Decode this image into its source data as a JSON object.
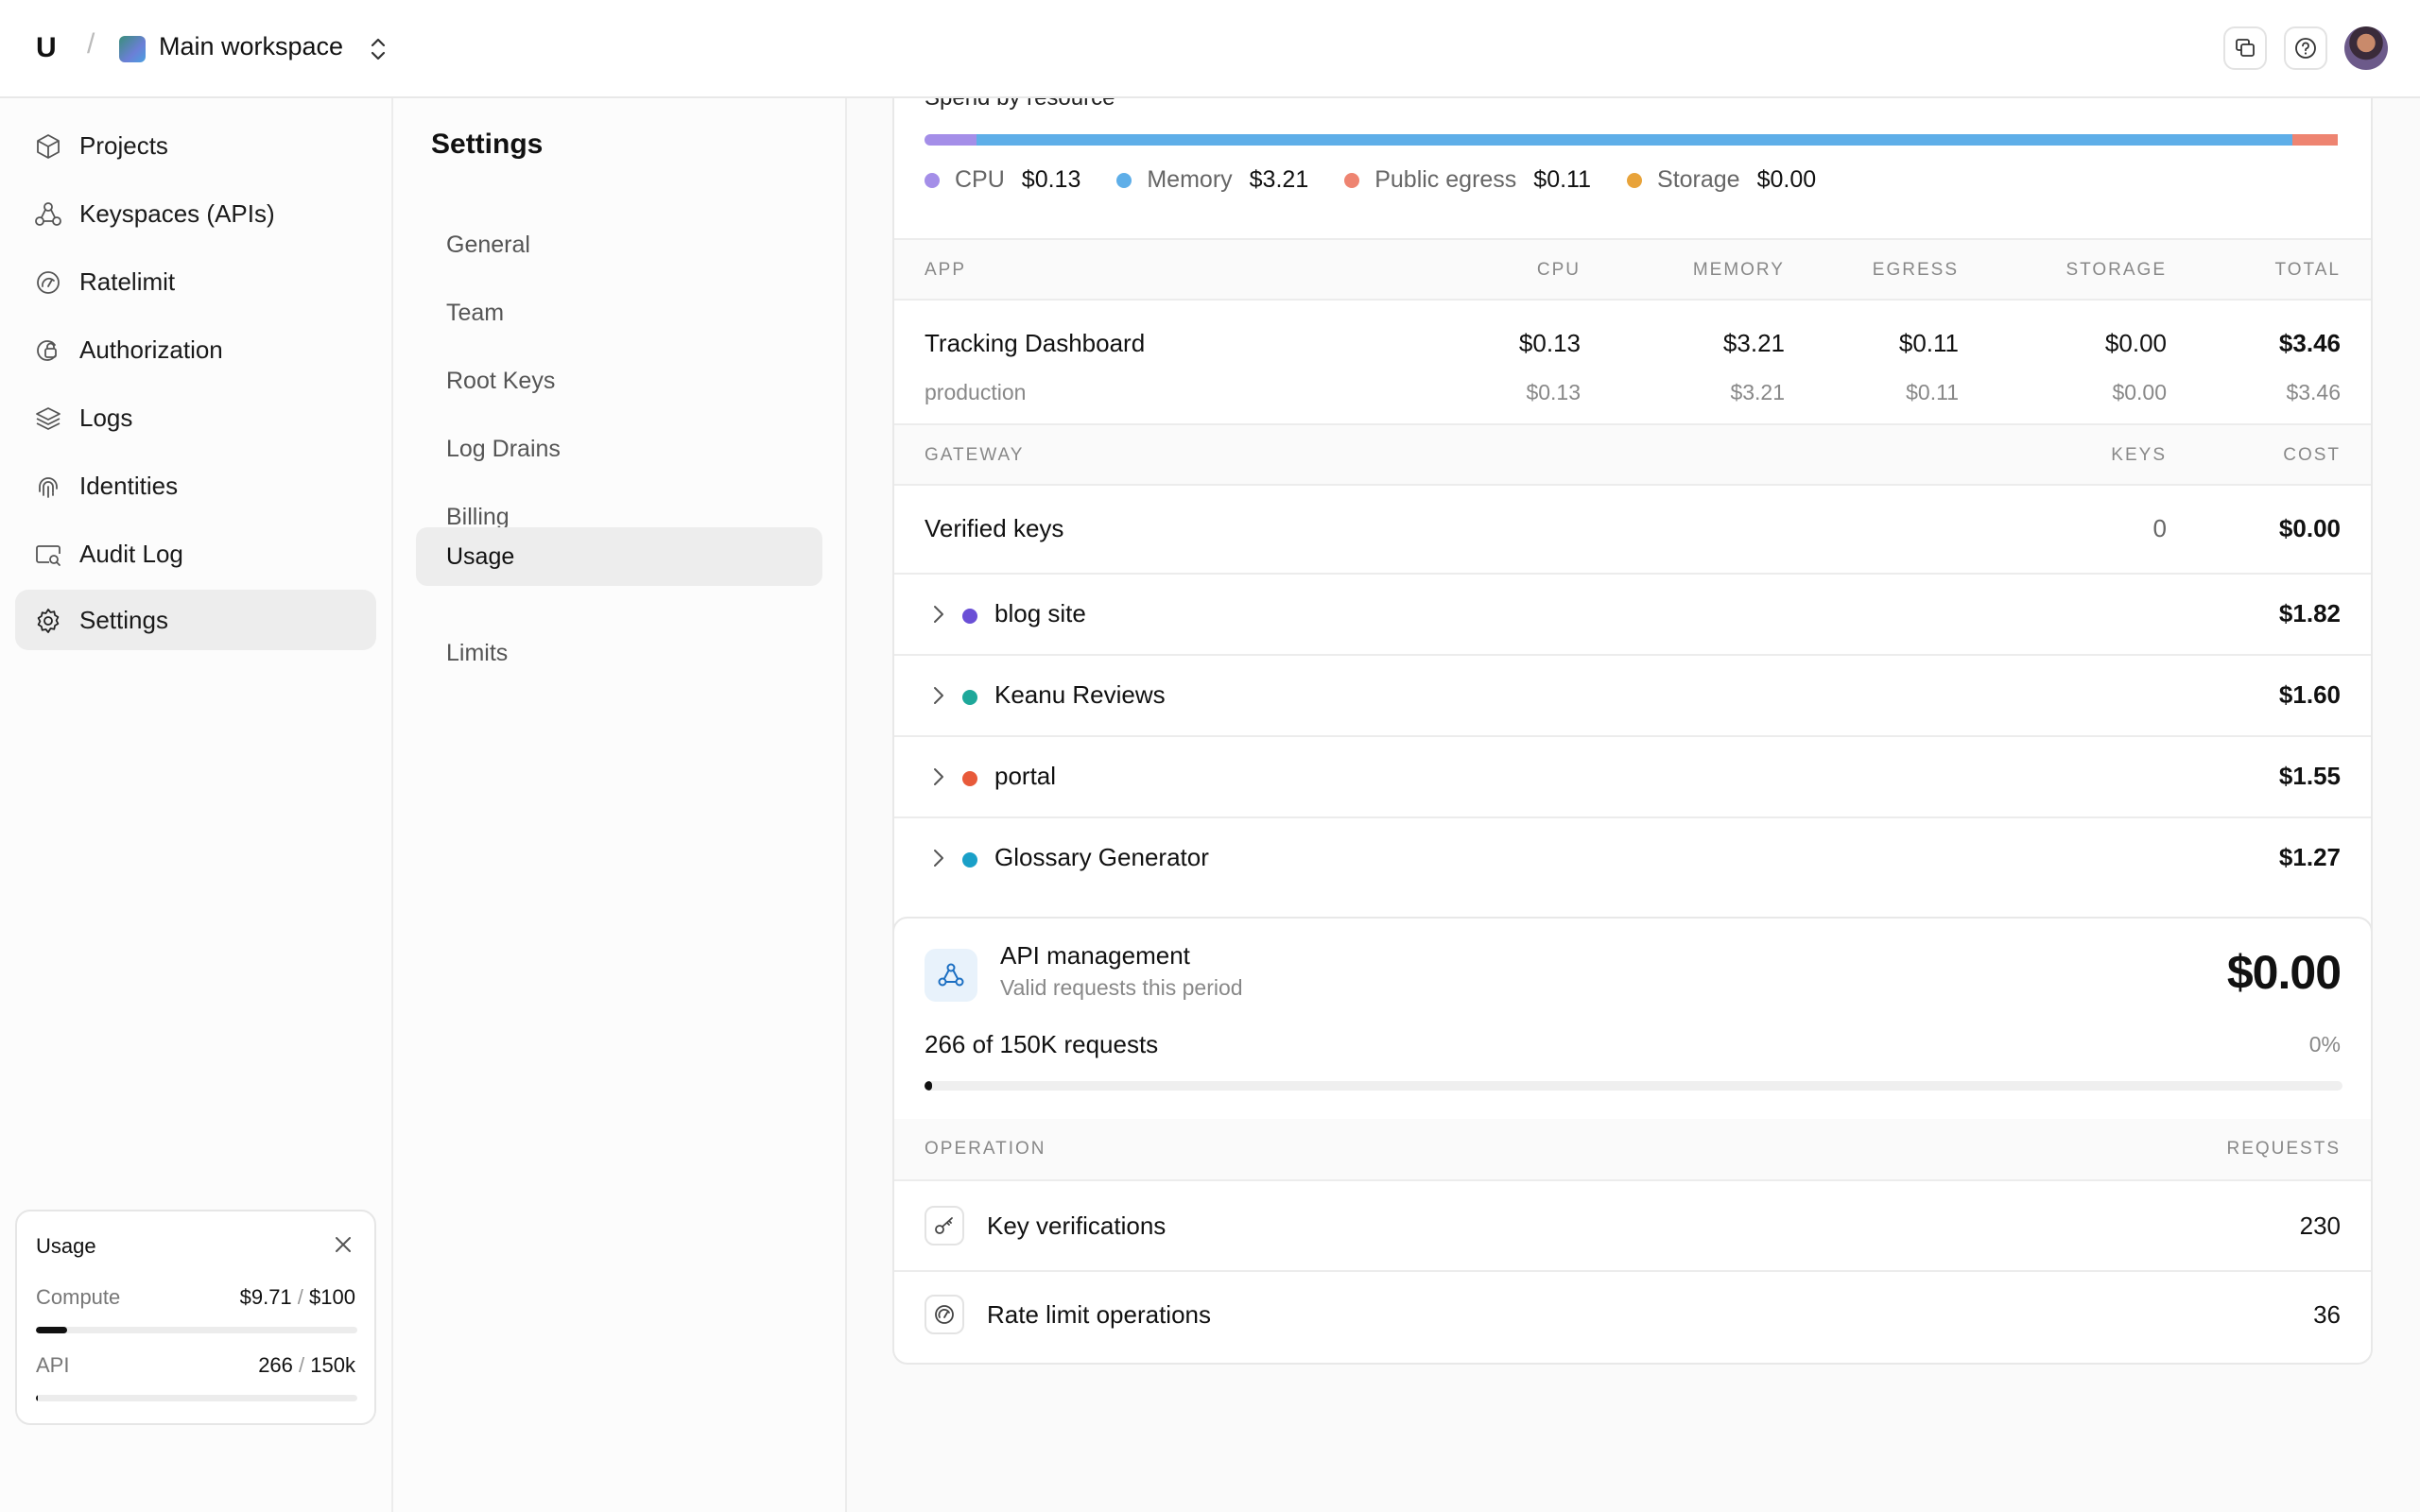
{
  "topbar": {
    "logo": "U",
    "separator": "/",
    "workspace_name": "Main workspace"
  },
  "sidebar": {
    "items": [
      {
        "label": "Projects",
        "icon": "cube-icon"
      },
      {
        "label": "Keyspaces (APIs)",
        "icon": "nodes-icon"
      },
      {
        "label": "Ratelimit",
        "icon": "gauge-icon"
      },
      {
        "label": "Authorization",
        "icon": "shield-lock-icon"
      },
      {
        "label": "Logs",
        "icon": "layers-icon"
      },
      {
        "label": "Identities",
        "icon": "fingerprint-icon"
      },
      {
        "label": "Audit Log",
        "icon": "search-window-icon"
      },
      {
        "label": "Settings",
        "icon": "gear-icon"
      }
    ],
    "active": "Settings",
    "usage_card": {
      "title": "Usage",
      "compute_label": "Compute",
      "compute_used": "$9.71",
      "compute_sep": "/",
      "compute_limit": "$100",
      "compute_fraction": 0.0971,
      "api_label": "API",
      "api_used": "266",
      "api_sep": "/",
      "api_limit": "150k",
      "api_fraction": 0.0018
    }
  },
  "settings": {
    "title": "Settings",
    "items": [
      "General",
      "Team",
      "Root Keys",
      "Log Drains",
      "Billing",
      "Usage",
      "Limits"
    ],
    "active": "Usage"
  },
  "spend": {
    "title": "Spend by resource",
    "colors": {
      "cpu": "#a48ee8",
      "memory": "#5eaee8",
      "egress": "#ee8471",
      "storage": "#e8a33a"
    },
    "fractions": {
      "cpu": 0.037,
      "memory": 0.928,
      "egress": 0.032,
      "storage": 0.0
    },
    "legend": [
      {
        "name": "CPU",
        "value": "$0.13"
      },
      {
        "name": "Memory",
        "value": "$3.21"
      },
      {
        "name": "Public egress",
        "value": "$0.11"
      },
      {
        "name": "Storage",
        "value": "$0.00"
      }
    ]
  },
  "app_table": {
    "headers": [
      "APP",
      "CPU",
      "MEMORY",
      "EGRESS",
      "STORAGE",
      "TOTAL"
    ],
    "row": {
      "name": "Tracking Dashboard",
      "cpu": "$0.13",
      "memory": "$3.21",
      "egress": "$0.11",
      "storage": "$0.00",
      "total": "$3.46"
    },
    "sub": {
      "name": "production",
      "cpu": "$0.13",
      "memory": "$3.21",
      "egress": "$0.11",
      "storage": "$0.00",
      "total": "$3.46"
    }
  },
  "gateway_table": {
    "headers": [
      "GATEWAY",
      "KEYS",
      "COST"
    ],
    "row": {
      "name": "Verified keys",
      "keys": "0",
      "cost": "$0.00"
    }
  },
  "apps": [
    {
      "name": "blog site",
      "cost": "$1.82",
      "color": "#6a4fd6"
    },
    {
      "name": "Keanu Reviews",
      "cost": "$1.60",
      "color": "#1ea89a"
    },
    {
      "name": "portal",
      "cost": "$1.55",
      "color": "#e85a3a"
    },
    {
      "name": "Glossary Generator",
      "cost": "$1.27",
      "color": "#1aa0c8"
    }
  ],
  "api_management": {
    "title": "API management",
    "subtitle": "Valid requests this period",
    "amount": "$0.00",
    "requests_text": "266 of 150K requests",
    "percent": "0%",
    "fraction": 0.0018,
    "headers": [
      "OPERATION",
      "REQUESTS"
    ],
    "operations": [
      {
        "name": "Key verifications",
        "count": "230",
        "icon": "key-icon"
      },
      {
        "name": "Rate limit operations",
        "count": "36",
        "icon": "gauge-icon"
      }
    ]
  }
}
